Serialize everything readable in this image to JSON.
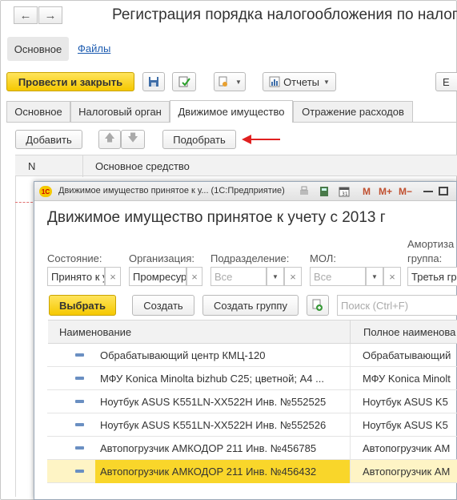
{
  "main": {
    "title": "Регистрация порядка налогообложения по налогу",
    "nav": {
      "back": "←",
      "forward": "→"
    },
    "sections": [
      "Основное",
      "Файлы"
    ],
    "toolbar": {
      "post_close": "Провести и закрыть",
      "reports": "Отчеты",
      "more": "Е"
    },
    "tabs": [
      "Основное",
      "Налоговый орган",
      "Движимое имущество",
      "Отражение расходов"
    ],
    "subtoolbar": {
      "add": "Добавить",
      "pick": "Подобрать"
    },
    "grid_headers": {
      "n": "N",
      "asset": "Основное средство"
    }
  },
  "dialog": {
    "window_title": "Движимое имущество принятое к у... (1С:Предприятие)",
    "heading": "Движимое имущество принятое к учету с 2013 г",
    "title_buttons": [
      "M",
      "M+",
      "M−"
    ],
    "filters": {
      "state_label": "Состояние:",
      "state_value": "Принято к у",
      "org_label": "Организация:",
      "org_value": "Промресур",
      "dept_label": "Подразделение:",
      "dept_placeholder": "Все",
      "mol_label": "МОЛ:",
      "mol_placeholder": "Все",
      "amort_label_1": "Амортиза",
      "amort_label_2": "группа:",
      "amort_value": "Третья гр"
    },
    "buttons": {
      "select": "Выбрать",
      "create": "Создать",
      "create_group": "Создать группу",
      "search_placeholder": "Поиск (Ctrl+F)"
    },
    "columns": [
      "Наименование",
      "Полное наименова"
    ],
    "rows": [
      {
        "name": "Обрабатывающий центр КМЦ-120",
        "full": "Обрабатывающий"
      },
      {
        "name": "МФУ Konica Minolta bizhub C25; цветной; A4  ...",
        "full": "МФУ Konica Minolt"
      },
      {
        "name": "Ноутбук ASUS K551LN-XX522H Инв. №552525",
        "full": "Ноутбук ASUS K5"
      },
      {
        "name": "Ноутбук ASUS K551LN-XX522H Инв. №552526",
        "full": "Ноутбук ASUS K5"
      },
      {
        "name": "Автопогрузчик АМКОДОР 211 Инв. №456785",
        "full": "Автопогрузчик АМ"
      },
      {
        "name": "Автопогрузчик АМКОДОР 211 Инв. №456432",
        "full": "Автопогрузчик АМ"
      }
    ],
    "selected_row": 5
  },
  "colors": {
    "accent_yellow": "#f5c800",
    "arrow_red": "#e02020",
    "link_blue": "#1c5bb0"
  }
}
